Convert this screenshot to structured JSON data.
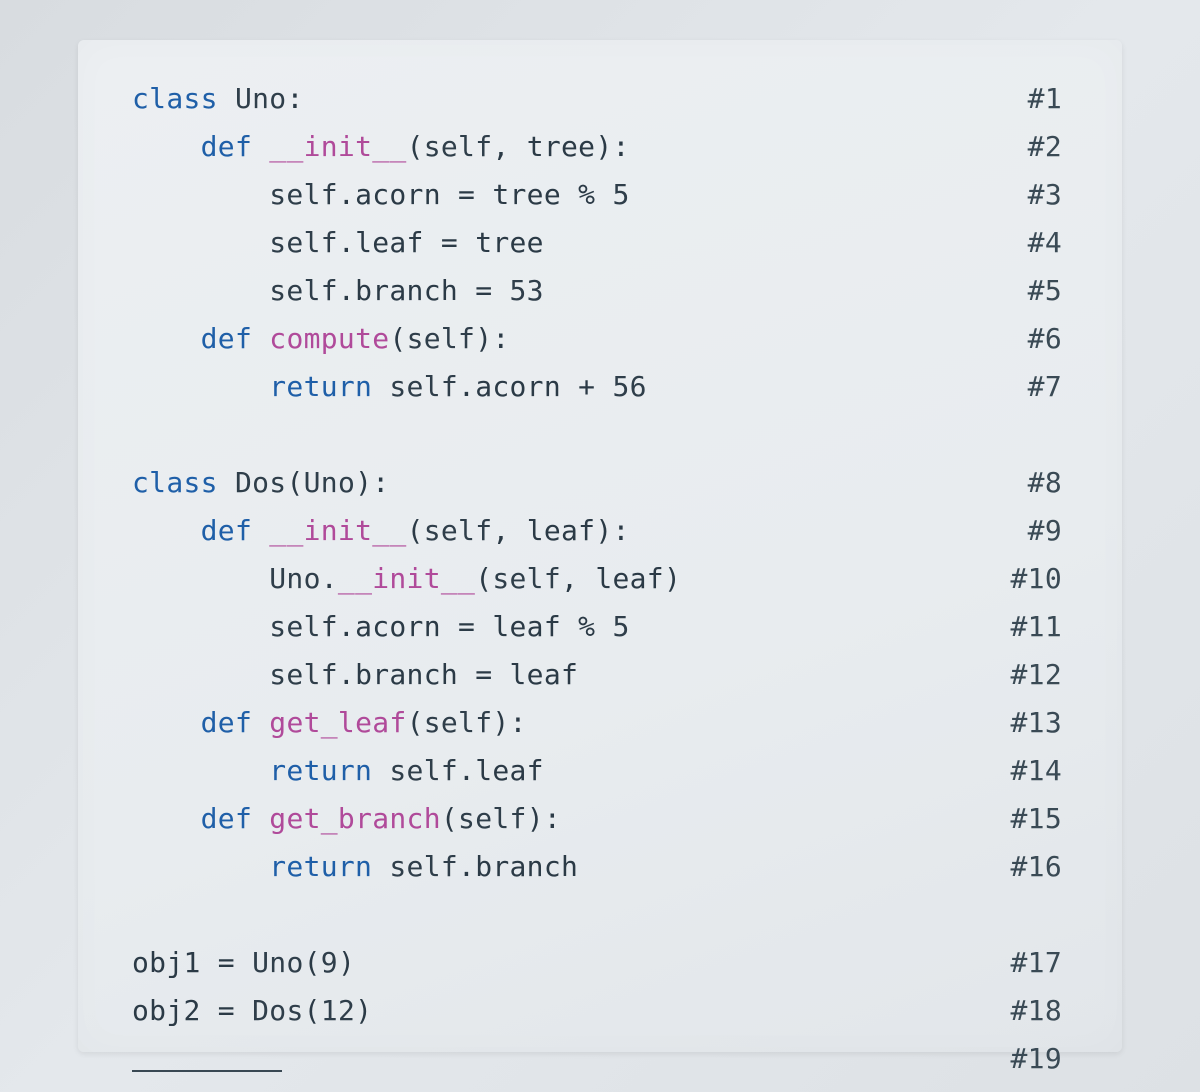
{
  "code": {
    "l1": "class Uno:",
    "l2": "    def __init__(self, tree):",
    "l3": "        self.acorn = tree % 5",
    "l4": "        self.leaf = tree",
    "l5": "        self.branch = 53",
    "l6": "    def compute(self):",
    "l7": "        return self.acorn + 56",
    "l8": "class Dos(Uno):",
    "l9": "    def __init__(self, leaf):",
    "l10": "        Uno.__init__(self, leaf)",
    "l11": "        self.acorn = leaf % 5",
    "l12": "        self.branch = leaf",
    "l13": "    def get_leaf(self):",
    "l14": "        return self.leaf",
    "l15": "    def get_branch(self):",
    "l16": "        return self.branch",
    "l17": "obj1 = Uno(9)",
    "l18": "obj2 = Dos(12)"
  },
  "nums": {
    "n1": "#1",
    "n2": "#2",
    "n3": "#3",
    "n4": "#4",
    "n5": "#5",
    "n6": "#6",
    "n7": "#7",
    "n8": "#8",
    "n9": "#9",
    "n10": "#10",
    "n11": "#11",
    "n12": "#12",
    "n13": "#13",
    "n14": "#14",
    "n15": "#15",
    "n16": "#16",
    "n17": "#17",
    "n18": "#18",
    "n19": "#19"
  },
  "tokens": {
    "class": "class",
    "def": "def",
    "return": "return",
    "Uno": "Uno",
    "Dos": "Dos",
    "init": "__init__",
    "compute": "compute",
    "get_leaf": "get_leaf",
    "get_branch": "get_branch",
    "self": "self",
    "tree": "tree",
    "leaf": "leaf",
    "acorn": "acorn",
    "branch": "branch",
    "obj1": "obj1",
    "obj2": "obj2",
    "n5": "5",
    "n9": "9",
    "n12": "12",
    "n53": "53",
    "n56": "56"
  }
}
